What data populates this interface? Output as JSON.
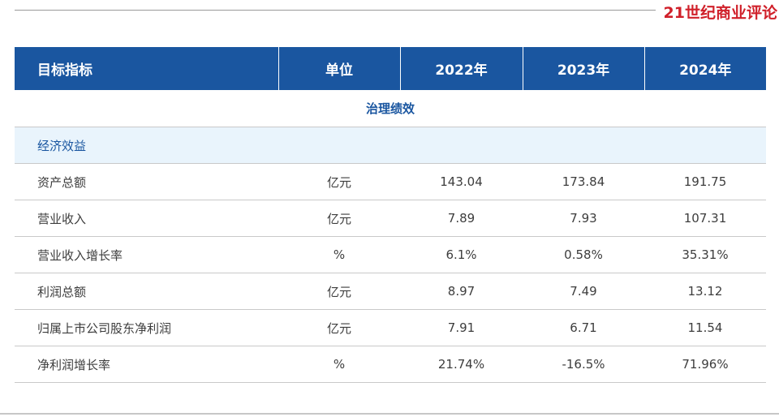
{
  "brand": {
    "logo_text": "21世纪商业评论"
  },
  "colors": {
    "header_bg": "#1a56a0",
    "category_bg": "#e9f4fc",
    "brand_red": "#d0202a"
  },
  "table": {
    "headers": [
      "目标指标",
      "单位",
      "2022年",
      "2023年",
      "2024年"
    ],
    "section_title": "治理绩效",
    "category": "经济效益",
    "rows": [
      {
        "metric": "资产总额",
        "unit": "亿元",
        "y2022": "143.04",
        "y2023": "173.84",
        "y2024": "191.75"
      },
      {
        "metric": "营业收入",
        "unit": "亿元",
        "y2022": "7.89",
        "y2023": "7.93",
        "y2024": "107.31"
      },
      {
        "metric": "营业收入增长率",
        "unit": "%",
        "y2022": "6.1%",
        "y2023": "0.58%",
        "y2024": "35.31%"
      },
      {
        "metric": "利润总额",
        "unit": "亿元",
        "y2022": "8.97",
        "y2023": "7.49",
        "y2024": "13.12"
      },
      {
        "metric": "归属上市公司股东净利润",
        "unit": "亿元",
        "y2022": "7.91",
        "y2023": "6.71",
        "y2024": "11.54"
      },
      {
        "metric": "净利润增长率",
        "unit": "%",
        "y2022": "21.74%",
        "y2023": "-16.5%",
        "y2024": "71.96%"
      }
    ]
  }
}
